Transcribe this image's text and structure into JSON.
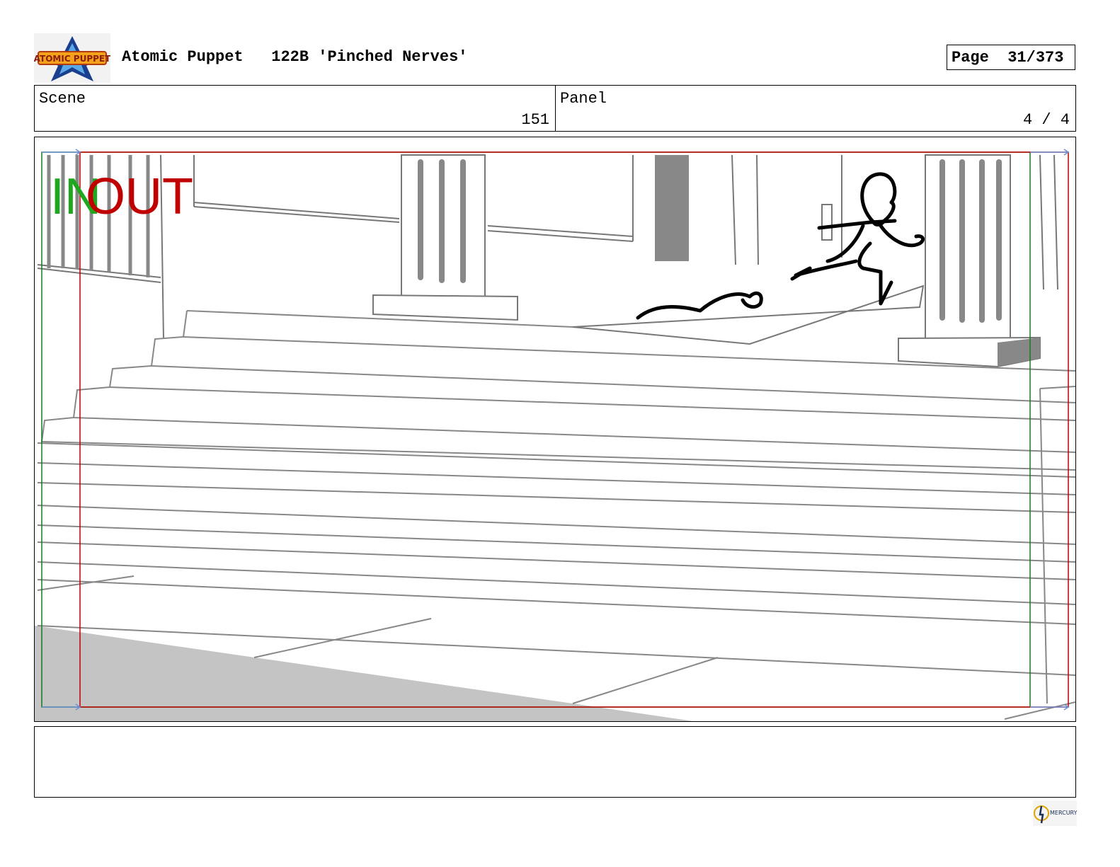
{
  "header": {
    "show_title": "Atomic Puppet",
    "episode": "122B 'Pinched Nerves'",
    "page_label": "Page",
    "page_value": "31/373",
    "logo_text": "ATOMIC PUPPET"
  },
  "info": {
    "scene_label": "Scene",
    "scene_value": "151",
    "panel_label": "Panel",
    "panel_value": "4 / 4"
  },
  "panel": {
    "in_marker": "IN",
    "out_marker": "OUT",
    "in_color": "#1fa81f",
    "out_color": "#c00000"
  },
  "notes": {
    "text": ""
  },
  "footer": {
    "studio_text": "MERCURY"
  }
}
